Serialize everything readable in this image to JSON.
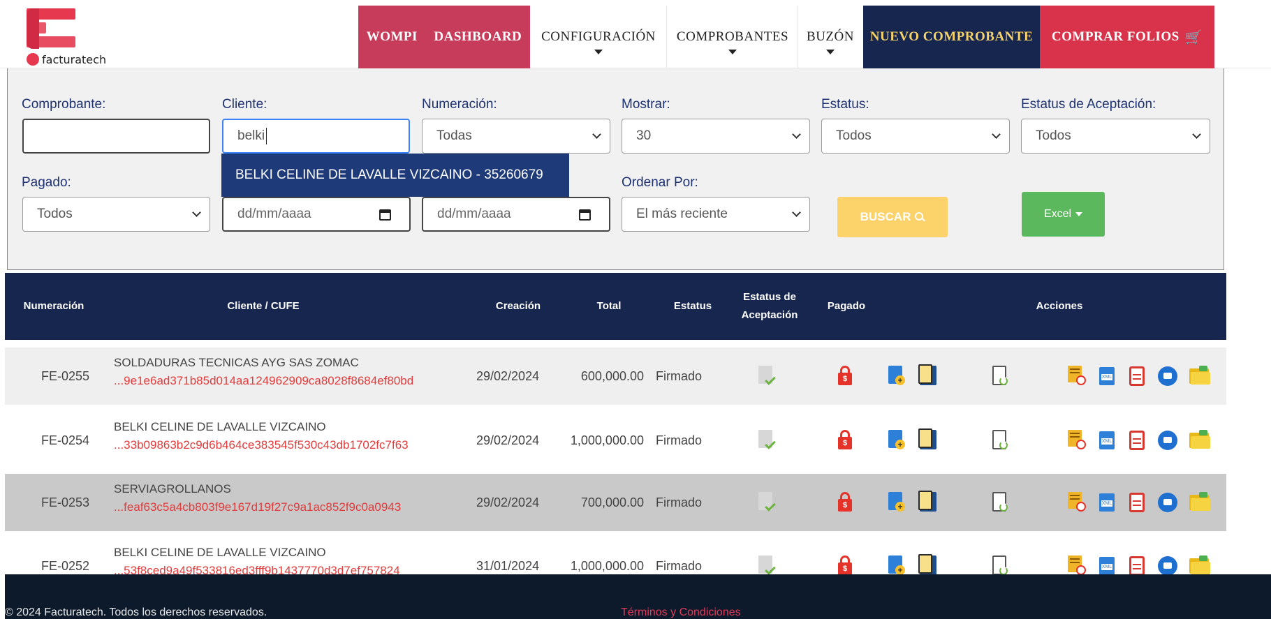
{
  "brand": {
    "name": "facturatech"
  },
  "nav": {
    "wompi": "WOMPI",
    "dashboard": "DASHBOARD",
    "configuracion": "CONFIGURACIÓN",
    "comprobantes": "COMPROBANTES",
    "buzon": "BUZÓN",
    "nuevo_comprobante": "NUEVO COMPROBANTE",
    "comprar_folios": "COMPRAR FOLIOS"
  },
  "filters": {
    "comprobante": {
      "label": "Comprobante:",
      "value": ""
    },
    "cliente": {
      "label": "Cliente:",
      "value": "belki"
    },
    "numeracion": {
      "label": "Numeración:",
      "value": "Todas"
    },
    "mostrar": {
      "label": "Mostrar:",
      "value": "30"
    },
    "estatus": {
      "label": "Estatus:",
      "value": "Todos"
    },
    "estatus_aceptacion": {
      "label": "Estatus de Aceptación:",
      "value": "Todos"
    },
    "pagado": {
      "label": "Pagado:",
      "value": "Todos"
    },
    "fecha_desde": {
      "placeholder": "dd/mm/aaaa"
    },
    "fecha_hasta": {
      "placeholder": "dd/mm/aaaa"
    },
    "ordenar": {
      "label": "Ordenar Por:",
      "value": "El más reciente"
    },
    "suggestion": "BELKI CELINE DE LAVALLE VIZCAINO - 35260679",
    "buscar_label": "BUSCAR",
    "excel_label": "Excel"
  },
  "table": {
    "headers": {
      "numeracion": "Numeración",
      "cliente": "Cliente / CUFE",
      "creacion": "Creación",
      "total": "Total",
      "estatus": "Estatus",
      "aceptacion_1": "Estatus de",
      "aceptacion_2": "Aceptación",
      "pagado": "Pagado",
      "acciones": "Acciones"
    },
    "rows": [
      {
        "num": "FE-0255",
        "client": "SOLDADURAS TECNICAS AYG SAS ZOMAC",
        "cufe": "...9e1e6ad371b85d014aa124962909ca8028f8684ef80bd",
        "date": "29/02/2024",
        "total": "600,000.00",
        "status": "Firmado"
      },
      {
        "num": "FE-0254",
        "client": "BELKI CELINE DE LAVALLE VIZCAINO",
        "cufe": "...33b09863b2c9d6b464ce383545f530c43db1702fc7f63",
        "date": "29/02/2024",
        "total": "1,000,000.00",
        "status": "Firmado"
      },
      {
        "num": "FE-0253",
        "client": "SERVIAGROLLANOS",
        "cufe": "...feaf63c5a4cb803f9e167d19f27c9a1ac852f9c0a0943",
        "date": "29/02/2024",
        "total": "700,000.00",
        "status": "Firmado"
      },
      {
        "num": "FE-0252",
        "client": "BELKI CELINE DE LAVALLE VIZCAINO",
        "cufe": "...53f8ced9a49f533816ed3fff9b1437770d3d7ef757824",
        "date": "31/01/2024",
        "total": "1,000,000.00",
        "status": "Firmado"
      }
    ]
  },
  "footer": {
    "copyright": "© 2024 Facturatech. Todos los derechos reservados.",
    "terms": "Términos y Condiciones"
  }
}
